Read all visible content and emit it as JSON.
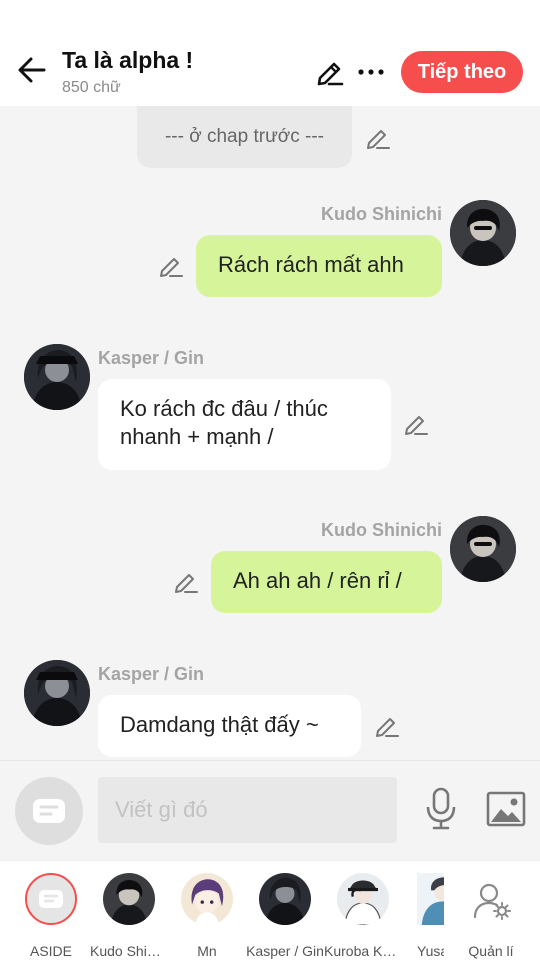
{
  "header": {
    "title": "Ta là alpha !",
    "word_count": "850 chữ",
    "next_button": "Tiếp theo",
    "back_icon": "arrow-left",
    "edit_icon": "pencil",
    "more_icon": "more-horizontal"
  },
  "chat": {
    "previous_chapter_label": "--- ở chap trước ---",
    "messages": [
      {
        "side": "right",
        "sender": "Kudo Shinichi",
        "text": "Rách rách mất ahh"
      },
      {
        "side": "left",
        "sender": "Kasper / Gin",
        "text": "Ko rách đc đâu / thúc nhanh + mạnh /"
      },
      {
        "side": "right",
        "sender": "Kudo Shinichi",
        "text": "Ah ah ah / rên rỉ /"
      },
      {
        "side": "left",
        "sender": "Kasper / Gin",
        "text": "Damdang thật đấy ~"
      }
    ]
  },
  "composer": {
    "placeholder": "Viết gì đó",
    "aside_icon": "chat-bubble",
    "mic_icon": "microphone",
    "image_icon": "image"
  },
  "characters": [
    {
      "label": "ASIDE"
    },
    {
      "label": "Kudo Shinichi"
    },
    {
      "label": "Mn"
    },
    {
      "label": "Kasper / Gin"
    },
    {
      "label": "Kuroba Kaito"
    },
    {
      "label": "Yusa"
    },
    {
      "label": "Quản lí"
    }
  ],
  "colors": {
    "accent": "#f64d4d",
    "bubble_right": "#d6f59a",
    "bubble_left": "#ffffff",
    "background": "#f4f4f4"
  }
}
